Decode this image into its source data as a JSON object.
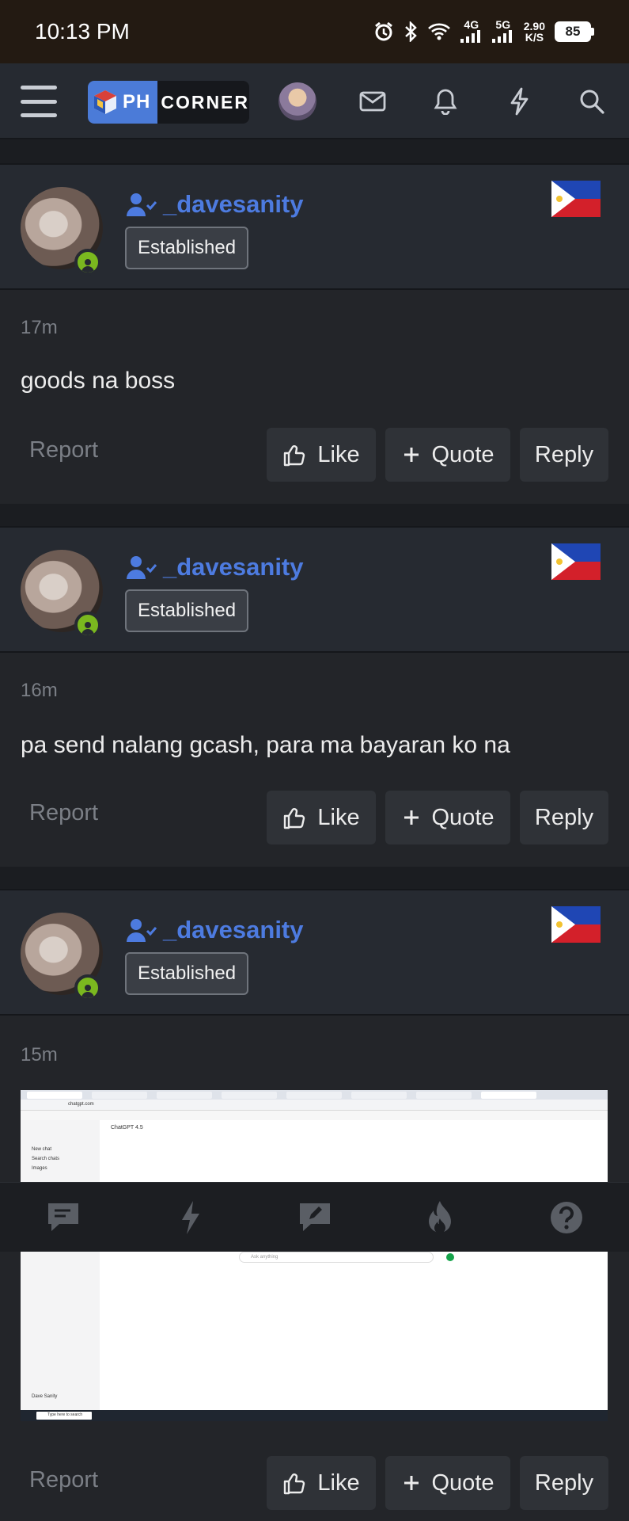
{
  "status_bar": {
    "time": "10:13 PM",
    "net_4g": "4G",
    "net_5g": "5G",
    "speed_value": "2.90",
    "speed_unit": "K/S",
    "battery": "85"
  },
  "header": {
    "logo_ph": "PH",
    "logo_corner": "CORNER"
  },
  "posts": [
    {
      "username": "_davesanity",
      "badge": "Established",
      "time": "17m",
      "text": "goods na boss",
      "report": "Report",
      "like": "Like",
      "quote": "Quote",
      "reply": "Reply"
    },
    {
      "username": "_davesanity",
      "badge": "Established",
      "time": "16m",
      "text": "pa send nalang gcash, para ma bayaran ko na",
      "report": "Report",
      "like": "Like",
      "quote": "Quote",
      "reply": "Reply"
    },
    {
      "username": "_davesanity",
      "badge": "Established",
      "time": "15m",
      "report": "Report",
      "like": "Like",
      "quote": "Quote",
      "reply": "Reply",
      "attachment": {
        "url": "chatgpt.com",
        "model": "ChatGPT 4.5",
        "menu_new_chat": "New chat",
        "menu_search": "Search chats",
        "menu_images": "Images",
        "input_placeholder": "Ask anything",
        "user_name": "Dave Sanity",
        "taskbar_search": "Type here to search"
      }
    }
  ],
  "bottom_nav": {
    "icons": [
      "chat-icon",
      "lightning-icon",
      "edit-icon",
      "fire-icon",
      "help-icon"
    ]
  },
  "colors": {
    "accent": "#4d7be0",
    "online": "#7ab81f",
    "panel": "#262a31",
    "body": "#232529"
  }
}
